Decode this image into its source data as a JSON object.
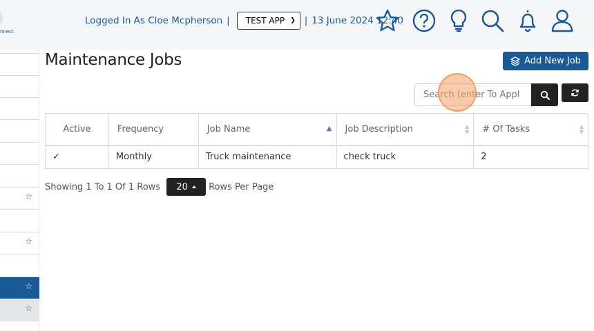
{
  "header": {
    "logo_fragment": "nnect",
    "logged_in_text": "Logged In As Cloe Mcpherson",
    "separator": "|",
    "app_select_value": "TEST APP",
    "date_text": "13 June 2024 12:40",
    "icons": [
      "star-icon",
      "help-icon",
      "lightbulb-icon",
      "search-icon",
      "bell-icon",
      "user-icon"
    ]
  },
  "sidebar": {
    "star_glyph": "☆"
  },
  "page": {
    "title": "Maintenance Jobs",
    "add_button_label": "Add New Job",
    "search_placeholder": "Search (enter To Appl"
  },
  "table": {
    "columns": [
      "Active",
      "Frequency",
      "Job Name",
      "Job Description",
      "# Of Tasks"
    ],
    "rows": [
      {
        "active": "✓",
        "frequency": "Monthly",
        "job_name": "Truck maintenance",
        "job_description": "check truck",
        "tasks": "2"
      }
    ]
  },
  "pagination": {
    "showing_text": "Showing 1 To 1 Of 1 Rows",
    "rows_per_page_value": "20",
    "rows_per_page_label": "Rows Per Page"
  },
  "colors": {
    "brand_blue": "#1a5a96",
    "dark_button": "#222222",
    "check_green": "#2e7d32"
  }
}
